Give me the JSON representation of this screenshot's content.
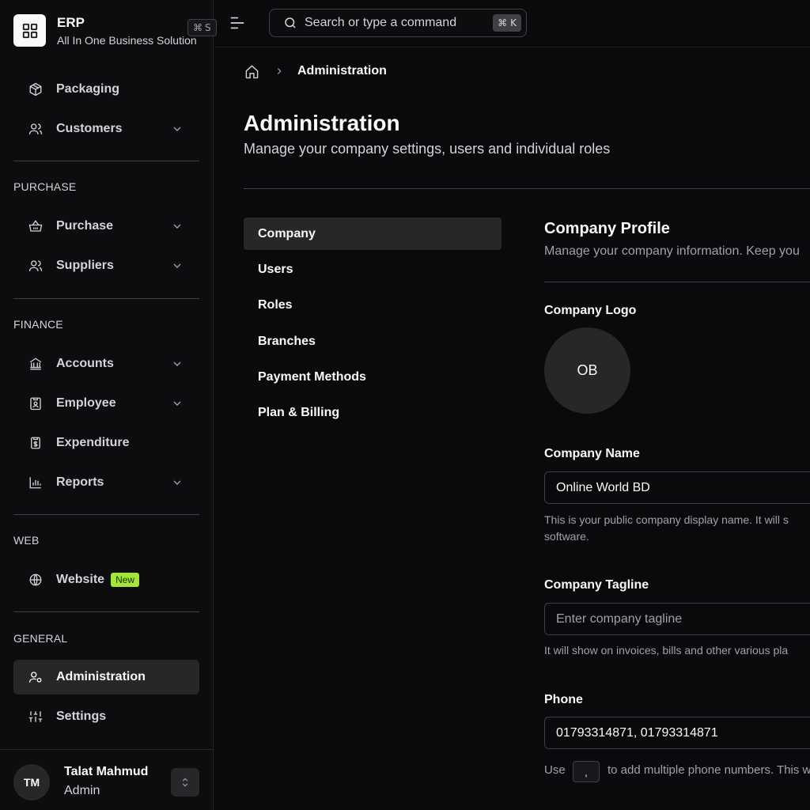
{
  "brand": {
    "title": "ERP",
    "subtitle": "All In One Business Solution",
    "shortcut_key": "S"
  },
  "sidebar": {
    "items_top": [
      {
        "label": "Packaging",
        "icon": "package-icon"
      },
      {
        "label": "Customers",
        "icon": "users-icon",
        "has_chevron": true
      }
    ],
    "sections": [
      {
        "title": "PURCHASE",
        "items": [
          {
            "label": "Purchase",
            "icon": "basket-icon"
          },
          {
            "label": "Suppliers",
            "icon": "users-icon"
          }
        ]
      },
      {
        "title": "FINANCE",
        "items": [
          {
            "label": "Accounts",
            "icon": "bank-icon"
          },
          {
            "label": "Employee",
            "icon": "badge-icon"
          },
          {
            "label": "Expenditure",
            "icon": "receipt-icon"
          },
          {
            "label": "Reports",
            "icon": "bar-chart-icon"
          }
        ]
      },
      {
        "title": "WEB",
        "items": [
          {
            "label": "Website",
            "icon": "globe-icon",
            "badge": "New"
          }
        ]
      },
      {
        "title": "GENERAL",
        "items": [
          {
            "label": "Administration",
            "icon": "user-cog-icon",
            "active": true
          },
          {
            "label": "Settings",
            "icon": "sliders-icon"
          }
        ]
      }
    ]
  },
  "user": {
    "initials": "TM",
    "name": "Talat Mahmud",
    "role": "Admin"
  },
  "topbar": {
    "search_placeholder": "Search or type a command",
    "search_shortcut": "K"
  },
  "breadcrumb": {
    "current": "Administration"
  },
  "page": {
    "title": "Administration",
    "subtitle": "Manage your company settings, users and individual roles"
  },
  "subnav": [
    {
      "label": "Company",
      "active": true
    },
    {
      "label": "Users"
    },
    {
      "label": "Roles"
    },
    {
      "label": "Branches"
    },
    {
      "label": "Payment Methods"
    },
    {
      "label": "Plan & Billing"
    }
  ],
  "profile": {
    "title": "Company Profile",
    "subtitle": "Manage your company information. Keep you",
    "logo_label": "Company Logo",
    "logo_initials": "OB",
    "name_label": "Company Name",
    "name_value": "Online World BD",
    "name_help_1": "This is your public company display name. It will s",
    "name_help_2": "software.",
    "tagline_label": "Company Tagline",
    "tagline_placeholder": "Enter company tagline",
    "tagline_help": "It will show on invoices, bills and other various pla",
    "phone_label": "Phone",
    "phone_value": "01793314871, 01793314871",
    "phone_help_use": "Use",
    "phone_help_key": ",",
    "phone_help_rest": "to add multiple phone numbers. This w"
  }
}
